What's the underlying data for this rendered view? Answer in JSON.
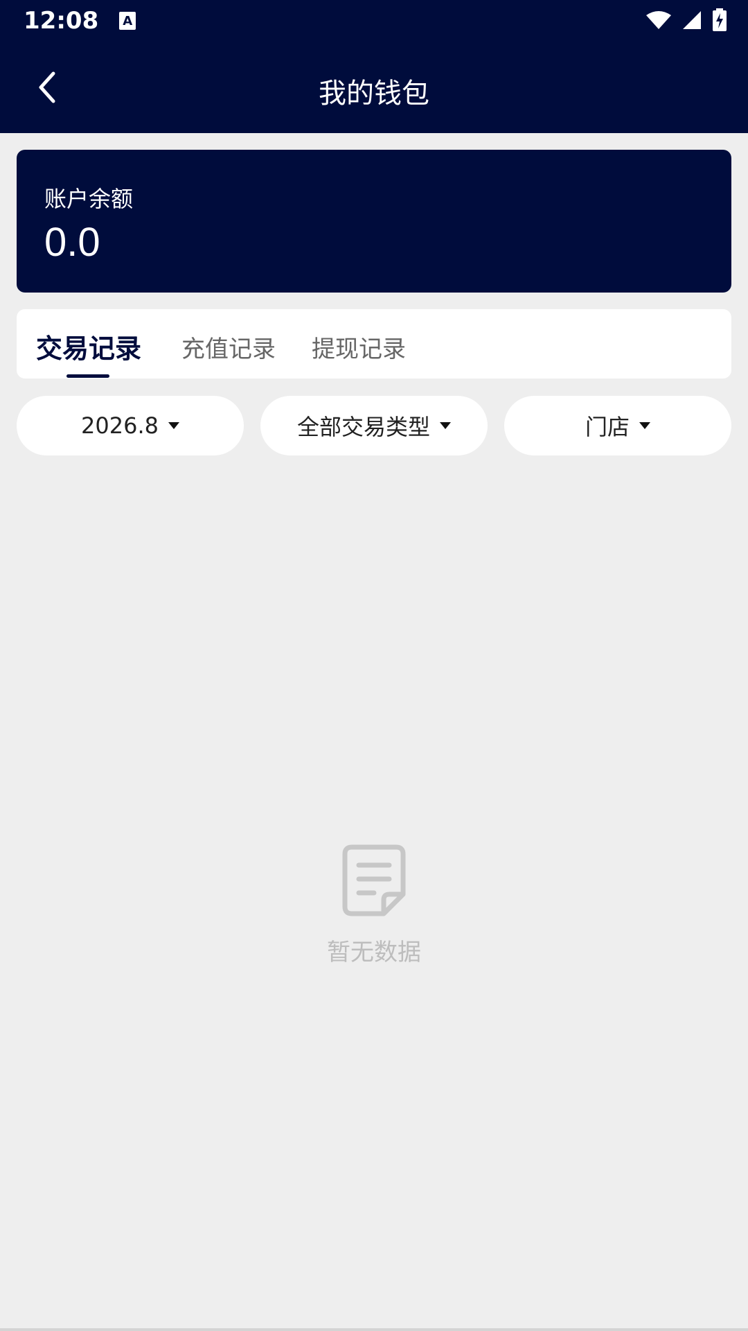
{
  "status_bar": {
    "time": "12:08",
    "notification_icon": "A",
    "icons": [
      "wifi-icon",
      "signal-icon",
      "battery-charging-icon"
    ]
  },
  "header": {
    "title": "我的钱包",
    "back_icon": "chevron-left-icon"
  },
  "balance": {
    "label": "账户余额",
    "value": "0.0"
  },
  "tabs": [
    {
      "label": "交易记录",
      "active": true
    },
    {
      "label": "充值记录",
      "active": false
    },
    {
      "label": "提现记录",
      "active": false
    }
  ],
  "filters": [
    {
      "label": "2026.8"
    },
    {
      "label": "全部交易类型"
    },
    {
      "label": "门店"
    }
  ],
  "empty_state": {
    "icon": "document-icon",
    "text": "暂无数据"
  },
  "colors": {
    "primary": "#000c3c",
    "background": "#eeeeee",
    "empty_text": "#bdbdbd"
  }
}
